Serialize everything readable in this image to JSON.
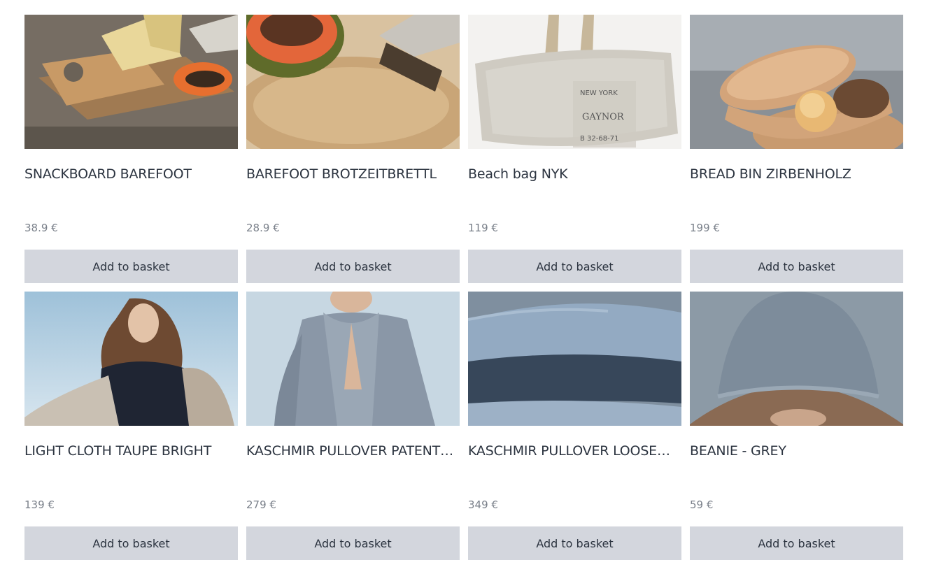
{
  "products": [
    {
      "title": "SNACKBOARD BAREFOOT",
      "price": "38.9 €",
      "button": "Add to basket",
      "image": "snackboard-photo"
    },
    {
      "title": "BAREFOOT BROTZEITBRETTL",
      "price": "28.9 €",
      "button": "Add to basket",
      "image": "brotzeitbrettl-photo"
    },
    {
      "title": "Beach bag NYK",
      "price": "119 €",
      "button": "Add to basket",
      "image": "beach-bag-photo"
    },
    {
      "title": "BREAD BIN ZIRBENHOLZ",
      "price": "199 €",
      "button": "Add to basket",
      "image": "bread-bin-photo"
    },
    {
      "title": "LIGHT CLOTH TAUPE BRIGHT",
      "price": "139 €",
      "button": "Add to basket",
      "image": "light-cloth-photo"
    },
    {
      "title": "KASCHMIR PULLOVER PATENT…",
      "price": "279 €",
      "button": "Add to basket",
      "image": "pullover-patent-photo"
    },
    {
      "title": "KASCHMIR PULLOVER LOOSE…",
      "price": "349 €",
      "button": "Add to basket",
      "image": "pullover-loose-photo"
    },
    {
      "title": "BEANIE - GREY",
      "price": "59 €",
      "button": "Add to basket",
      "image": "beanie-photo"
    }
  ],
  "colors": {
    "button_bg": "#d3d6dd",
    "text": "#2c3440",
    "price": "#7a808a"
  }
}
